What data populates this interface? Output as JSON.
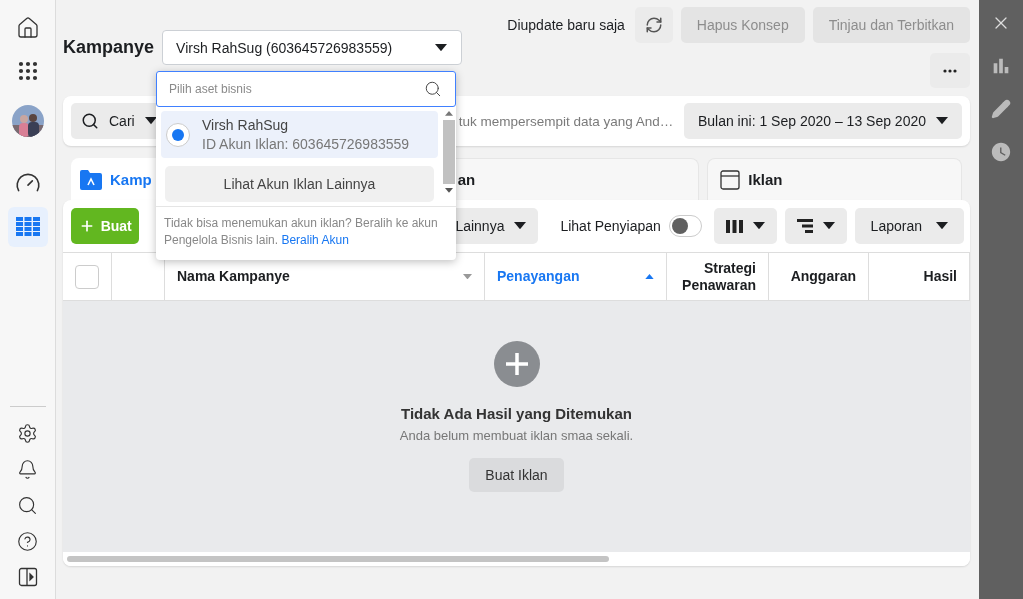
{
  "sidebar": {
    "items": [
      {
        "kind": "home",
        "selected": false
      },
      {
        "kind": "apps",
        "selected": false
      },
      {
        "kind": "avatar",
        "selected": false
      },
      {
        "kind": "gauge",
        "selected": false
      },
      {
        "kind": "table",
        "selected": true
      }
    ],
    "bottom_items": [
      {
        "kind": "settings"
      },
      {
        "kind": "bell"
      },
      {
        "kind": "search"
      },
      {
        "kind": "help"
      },
      {
        "kind": "panel"
      }
    ]
  },
  "header": {
    "title": "Kampanye",
    "account_select": {
      "value": "Virsh RahSug (603645726983559)"
    },
    "status": "Diupdate baru saja",
    "buttons": [
      {
        "label": "Hapus Konsep",
        "disabled": true
      },
      {
        "label": "Tinjau dan Terbitkan",
        "disabled": true
      }
    ]
  },
  "filter_bar": {
    "search_button": "Cari",
    "filter_text": "tuk mempersempit data yang And…",
    "date_range": "Bulan ini: 1 Sep 2020 – 13 Sep 2020"
  },
  "tabs": [
    {
      "label": "Kamp",
      "kind": "campaign",
      "selected": true
    },
    {
      "label": "an",
      "kind": "adset",
      "selected": false
    },
    {
      "label": "Iklan",
      "kind": "ad",
      "selected": false
    }
  ],
  "toolbar": {
    "create_button": "Buat",
    "more_button": "Lainnya",
    "setup_toggle": {
      "label": "Lihat Penyiapan",
      "on": false
    },
    "report_button": "Laporan"
  },
  "table": {
    "select_all": {
      "checked": false
    },
    "columns": [
      {
        "label": "Nama Kampanye",
        "kind": "sortable",
        "sorted": false
      },
      {
        "label": "Penayangan",
        "kind": "sortable",
        "sorted": true
      },
      {
        "label": "Strategi Penawaran",
        "kind": "plain",
        "sorted": false
      },
      {
        "label": "Anggaran",
        "kind": "plain",
        "sorted": false
      },
      {
        "label": "Hasil",
        "kind": "plain",
        "sorted": false
      }
    ],
    "empty_state": {
      "title": "Tidak Ada Hasil yang Ditemukan",
      "message": "Anda belum membuat iklan smaa sekali.",
      "button": "Buat Iklan"
    }
  },
  "account_dropdown": {
    "placeholder": "Pilih aset bisnis",
    "accounts": [
      {
        "name": "Virsh RahSug",
        "id": "ID Akun Iklan: 603645726983559",
        "selected": true
      }
    ],
    "more_button": "Lihat Akun Iklan Lainnya",
    "footer": "Tidak bisa menemukan akun iklan? Beralih ke akun Pengelola Bisnis lain.",
    "footer_link": "Beralih Akun"
  }
}
